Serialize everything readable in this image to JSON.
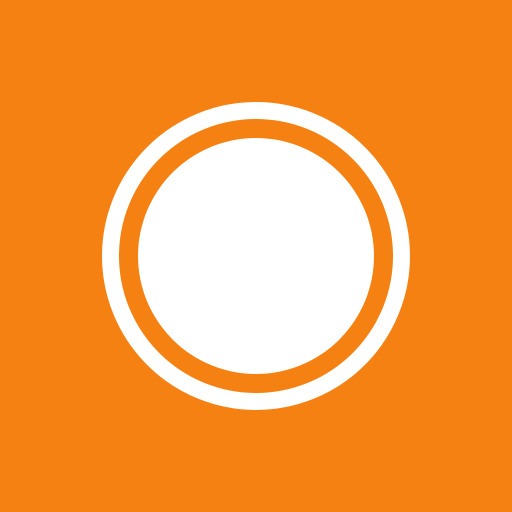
{
  "app_icon": {
    "icon_name": "record-icon",
    "colors": {
      "background": "#F58113",
      "foreground": "#FFFFFF"
    }
  }
}
